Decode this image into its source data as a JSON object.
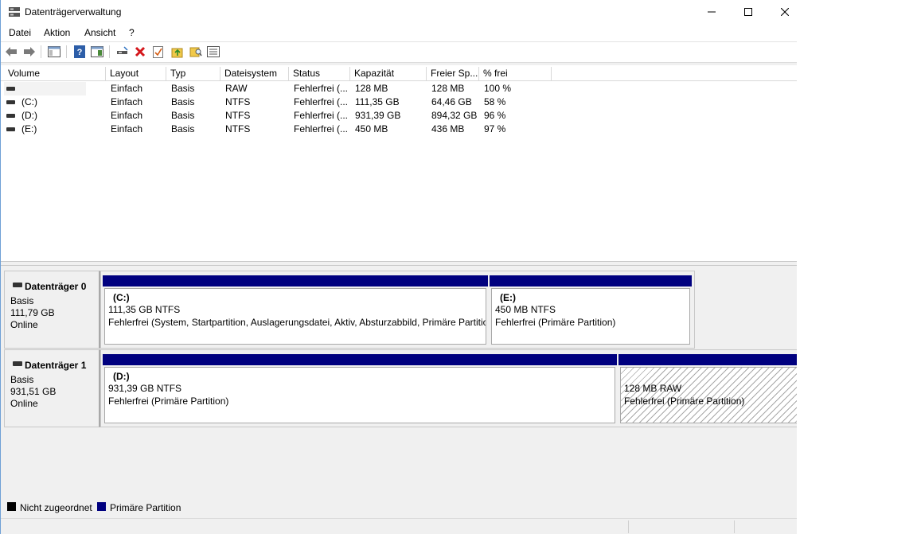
{
  "window": {
    "title": "Datenträgerverwaltung"
  },
  "menu": [
    "Datei",
    "Aktion",
    "Ansicht",
    "?"
  ],
  "toolbar": {
    "icons": [
      "back-icon",
      "forward-icon",
      "show-hide-console-icon",
      "help-icon",
      "properties-icon",
      "connect-icon",
      "delete-icon",
      "check-icon",
      "folder-up-icon",
      "search-icon",
      "list-view-icon"
    ]
  },
  "volume_list": {
    "columns": [
      "Volume",
      "Layout",
      "Typ",
      "Dateisystem",
      "Status",
      "Kapazität",
      "Freier Sp...",
      "% frei"
    ],
    "rows": [
      {
        "volume": "",
        "layout": "Einfach",
        "type": "Basis",
        "fs": "RAW",
        "status": "Fehlerfrei (...",
        "capacity": "128 MB",
        "free": "128 MB",
        "pct": "100 %"
      },
      {
        "volume": "(C:)",
        "layout": "Einfach",
        "type": "Basis",
        "fs": "NTFS",
        "status": "Fehlerfrei (...",
        "capacity": "111,35 GB",
        "free": "64,46 GB",
        "pct": "58 %"
      },
      {
        "volume": "(D:)",
        "layout": "Einfach",
        "type": "Basis",
        "fs": "NTFS",
        "status": "Fehlerfrei (...",
        "capacity": "931,39 GB",
        "free": "894,32 GB",
        "pct": "96 %"
      },
      {
        "volume": "(E:)",
        "layout": "Einfach",
        "type": "Basis",
        "fs": "NTFS",
        "status": "Fehlerfrei (...",
        "capacity": "450 MB",
        "free": "436 MB",
        "pct": "97 %"
      }
    ]
  },
  "disks": [
    {
      "name": "Datenträger 0",
      "type": "Basis",
      "size": "111,79 GB",
      "state": "Online",
      "partitions": [
        {
          "label": "(C:)",
          "size": "111,35 GB NTFS",
          "status": "Fehlerfrei (System, Startpartition, Auslagerungsdatei, Aktiv, Absturzabbild, Primäre Partition)"
        },
        {
          "label": "(E:)",
          "size": "450 MB NTFS",
          "status": "Fehlerfrei (Primäre Partition)"
        }
      ]
    },
    {
      "name": "Datenträger 1",
      "type": "Basis",
      "size": "931,51 GB",
      "state": "Online",
      "partitions": [
        {
          "label": "(D:)",
          "size": "931,39 GB NTFS",
          "status": "Fehlerfrei (Primäre Partition)"
        },
        {
          "label": "",
          "size": "128 MB RAW",
          "status": "Fehlerfrei (Primäre Partition)"
        }
      ]
    }
  ],
  "legend": [
    {
      "label": "Nicht zugeordnet",
      "color": "#000000"
    },
    {
      "label": "Primäre Partition",
      "color": "#00007f"
    }
  ],
  "colors": {
    "primary_partition": "#00007f",
    "unallocated": "#000000"
  }
}
